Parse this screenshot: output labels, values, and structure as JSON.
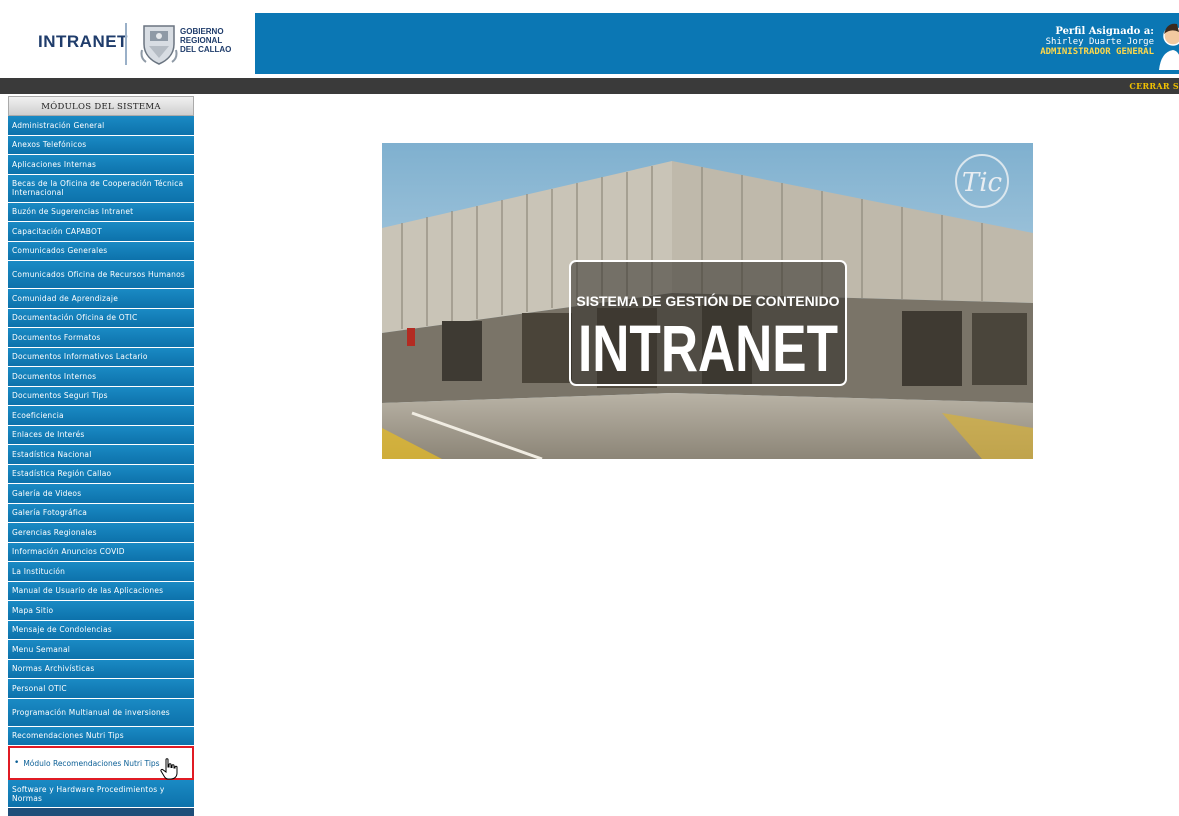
{
  "header": {
    "logo_text": "INTRANET",
    "logo_org_line1": "GOBIERNO",
    "logo_org_line2": "REGIONAL",
    "logo_org_line3": "DEL CALLAO",
    "profile_label": "Perfil Asignado a:",
    "profile_name": "Shirley Duarte Jorge",
    "profile_role": "ADMINISTRADOR GENERAL",
    "logout_label": "CERRAR S",
    "band_color": "#0b77b4"
  },
  "sidebar": {
    "title": "MÓDULOS DEL SISTEMA",
    "items": [
      {
        "label": "Administración General",
        "tall": false
      },
      {
        "label": "Anexos Telefónicos",
        "tall": false
      },
      {
        "label": "Aplicaciones Internas",
        "tall": false
      },
      {
        "label": "Becas de la Oficina de Cooperación Técnica Internacional",
        "tall": true
      },
      {
        "label": "Buzón de Sugerencias Intranet",
        "tall": false
      },
      {
        "label": "Capacitación CAPABOT",
        "tall": false
      },
      {
        "label": "Comunicados Generales",
        "tall": false
      },
      {
        "label": "Comunicados Oficina de Recursos Humanos",
        "tall": true
      },
      {
        "label": "Comunidad de Aprendizaje",
        "tall": false
      },
      {
        "label": "Documentación Oficina de OTIC",
        "tall": false
      },
      {
        "label": "Documentos Formatos",
        "tall": false
      },
      {
        "label": "Documentos Informativos Lactario",
        "tall": false
      },
      {
        "label": "Documentos Internos",
        "tall": false
      },
      {
        "label": "Documentos Seguri Tips",
        "tall": false
      },
      {
        "label": "Ecoeficiencia",
        "tall": false
      },
      {
        "label": "Enlaces de Interés",
        "tall": false
      },
      {
        "label": "Estadística Nacional",
        "tall": false
      },
      {
        "label": "Estadística Región Callao",
        "tall": false
      },
      {
        "label": "Galería de Videos",
        "tall": false
      },
      {
        "label": "Galería Fotográfica",
        "tall": false
      },
      {
        "label": "Gerencias Regionales",
        "tall": false
      },
      {
        "label": "Información Anuncios COVID",
        "tall": false
      },
      {
        "label": "La Institución",
        "tall": false
      },
      {
        "label": "Manual de Usuario de las Aplicaciones",
        "tall": false
      },
      {
        "label": "Mapa Sitio",
        "tall": false
      },
      {
        "label": "Mensaje de Condolencias",
        "tall": false
      },
      {
        "label": "Menu Semanal",
        "tall": false
      },
      {
        "label": "Normas Archivísticas",
        "tall": false
      },
      {
        "label": "Personal OTIC",
        "tall": false
      },
      {
        "label": "Programación Multianual de inversiones",
        "tall": true
      },
      {
        "label": "Recomendaciones Nutri Tips",
        "tall": false
      }
    ],
    "active_submenu": "Módulo Recomendaciones Nutri Tips",
    "trailing_item": "Software y Hardware Procedimientos y Normas"
  },
  "banner": {
    "subtitle": "SISTEMA DE GESTIÓN DE CONTENIDO",
    "title": "INTRANET",
    "badge": "Tic"
  }
}
